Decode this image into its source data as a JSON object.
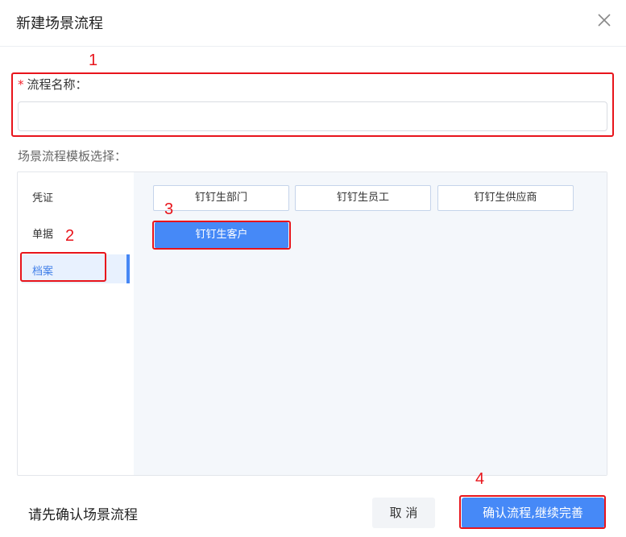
{
  "dialog": {
    "title": "新建场景流程"
  },
  "form": {
    "name_label": "流程名称：",
    "required_mark": "*",
    "name_value": "",
    "template_label": "场景流程模板选择："
  },
  "categories": [
    {
      "label": "凭证",
      "active": false
    },
    {
      "label": "单据",
      "active": false
    },
    {
      "label": "档案",
      "active": true
    }
  ],
  "templates": [
    {
      "label": "钉钉生部门",
      "selected": false
    },
    {
      "label": "钉钉生员工",
      "selected": false
    },
    {
      "label": "钉钉生供应商",
      "selected": false
    },
    {
      "label": "钉钉生客户",
      "selected": true
    }
  ],
  "footer": {
    "hint": "请先确认场景流程",
    "cancel_label": "取 消",
    "confirm_label": "确认流程,继续完善"
  },
  "annotations": [
    "1",
    "2",
    "3",
    "4"
  ],
  "colors": {
    "primary": "#4689f7",
    "annotation": "#e8141b",
    "active_bg": "#e8f1fe"
  },
  "icons": {
    "close": "close-icon"
  }
}
